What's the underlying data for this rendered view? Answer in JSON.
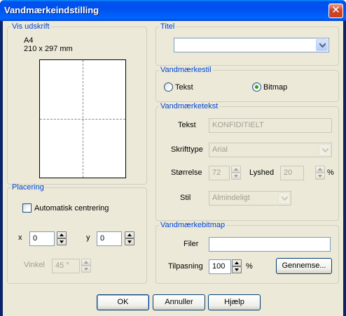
{
  "window": {
    "title": "Vandmærkeindstilling",
    "close_glyph": "✕"
  },
  "preview": {
    "legend": "Vis udskrift",
    "paper_name": "A4",
    "paper_size": "210 x 297 mm"
  },
  "placement": {
    "legend": "Placering",
    "auto_center_label": "Automatisk centrering",
    "auto_center_checked": false,
    "x_label": "x",
    "x_value": "0",
    "y_label": "y",
    "y_value": "0",
    "angle_label": "Vinkel",
    "angle_value": "45 °"
  },
  "title_group": {
    "legend": "Titel",
    "value": ""
  },
  "style_group": {
    "legend": "Vandmærkestil",
    "text_label": "Tekst",
    "bitmap_label": "Bitmap",
    "selected": "bitmap"
  },
  "text_group": {
    "legend": "Vandmærketekst",
    "text_label": "Tekst",
    "text_value": "KONFIDITIELT",
    "font_label": "Skrifttype",
    "font_value": "Arial",
    "size_label": "Størrelse",
    "size_value": "72",
    "opacity_label": "Lyshed",
    "opacity_value": "20",
    "opacity_unit": "%",
    "style_label": "Stil",
    "style_value": "Almindeligt"
  },
  "bitmap_group": {
    "legend": "Vandmærkebitmap",
    "file_label": "Filer",
    "file_value": "",
    "scale_label": "Tilpasning",
    "scale_value": "100",
    "scale_unit": "%",
    "browse_label": "Gennemse..."
  },
  "buttons": {
    "ok": "OK",
    "cancel": "Annuller",
    "help": "Hjælp"
  },
  "colors": {
    "titlebar": "#0054e3",
    "group_legend": "#0046d5",
    "client": "#ece9d8",
    "radio_dot": "#21a121"
  }
}
